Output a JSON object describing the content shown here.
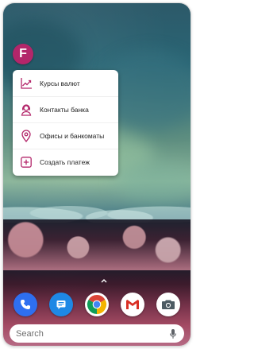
{
  "launcher": {
    "app_icon": {
      "icon": "finance-app-icon",
      "letter": "F",
      "color": "#b3266a"
    },
    "shortcuts": [
      {
        "label": "Курсы валют",
        "icon": "chart-trend-icon"
      },
      {
        "label": "Контакты банка",
        "icon": "support-agent-icon"
      },
      {
        "label": "Офисы и банкоматы",
        "icon": "map-pin-icon"
      },
      {
        "label": "Создать платеж",
        "icon": "plus-square-icon"
      }
    ],
    "accent_color": "#b3266a",
    "dock": [
      {
        "icon": "phone-icon",
        "color": "#2e6ff0"
      },
      {
        "icon": "messages-icon",
        "color": "#1e88e5"
      },
      {
        "icon": "chrome-icon",
        "color": "#ffffff"
      },
      {
        "icon": "gmail-icon",
        "color": "#ffffff"
      },
      {
        "icon": "camera-icon",
        "color": "#ffffff"
      }
    ],
    "search": {
      "placeholder": "Search",
      "icon": "mic-icon"
    }
  }
}
